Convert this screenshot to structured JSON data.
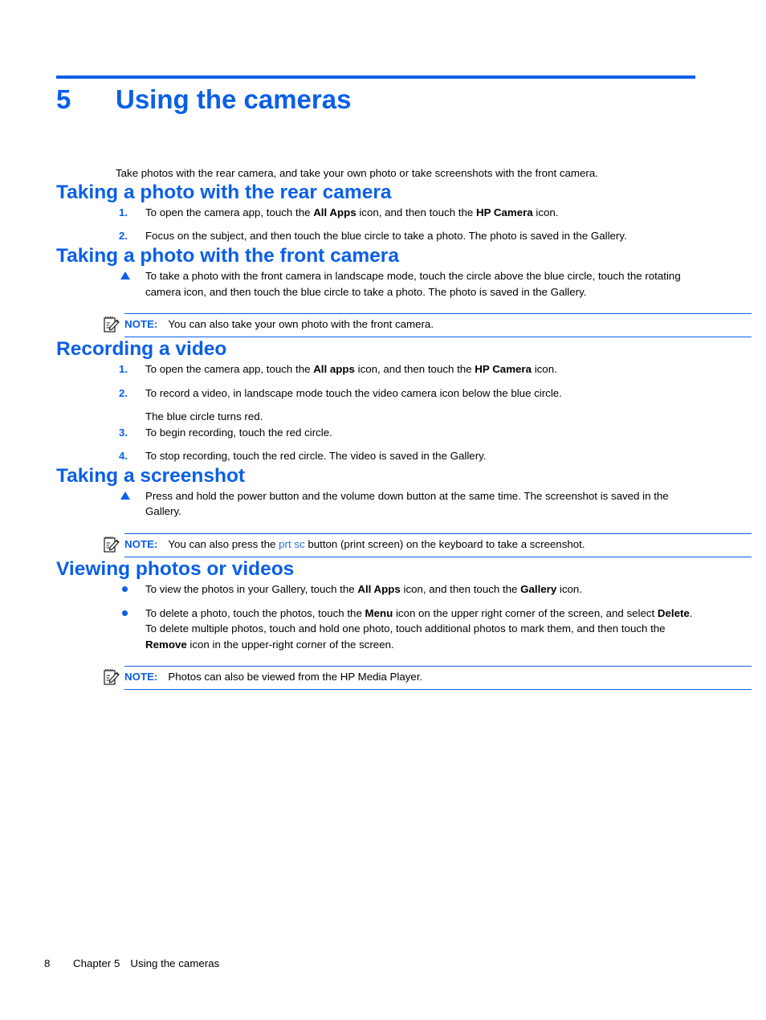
{
  "chapter": {
    "number": "5",
    "title": "Using the cameras"
  },
  "intro": "Take photos with the rear camera, and take your own photo or take screenshots with the front camera.",
  "sections": {
    "rear": {
      "heading": "Taking a photo with the rear camera",
      "step1_marker": "1.",
      "step1_a": "To open the camera app, touch the ",
      "step1_b": "All Apps",
      "step1_c": " icon, and then touch the ",
      "step1_d": "HP Camera",
      "step1_e": " icon.",
      "step2_marker": "2.",
      "step2_text": "Focus on the subject, and then touch the blue circle to take a photo. The photo is saved in the Gallery."
    },
    "front": {
      "heading": "Taking a photo with the front camera",
      "step_text": "To take a photo with the front camera in landscape mode, touch the circle above the blue circle, touch the rotating camera icon, and then touch the blue circle to take a photo. The photo is saved in the Gallery.",
      "note_label": "NOTE:",
      "note_text": "You can also take your own photo with the front camera."
    },
    "video": {
      "heading": "Recording a video",
      "step1_marker": "1.",
      "step1_a": "To open the camera app, touch the ",
      "step1_b": "All apps",
      "step1_c": " icon, and then touch the ",
      "step1_d": "HP Camera",
      "step1_e": " icon.",
      "step2_marker": "2.",
      "step2_text": "To record a video, in landscape mode touch the video camera icon below the blue circle.",
      "substep_text": "The blue circle turns red.",
      "step3_marker": "3.",
      "step3_text": "To begin recording, touch the red circle.",
      "step4_marker": "4.",
      "step4_text": "To stop recording, touch the red circle. The video is saved in the Gallery."
    },
    "screenshot": {
      "heading": "Taking a screenshot",
      "step_text": "Press and hold the power button and the volume down button at the same time. The screenshot is saved in the Gallery.",
      "note_label": "NOTE:",
      "note_a": "You can also press the ",
      "note_key": "prt sc",
      "note_b": " button (print screen) on the keyboard to take a screenshot."
    },
    "viewing": {
      "heading": "Viewing photos or videos",
      "bullet1_a": "To view the photos in your Gallery, touch the ",
      "bullet1_b": "All Apps",
      "bullet1_c": " icon, and then touch the ",
      "bullet1_d": "Gallery",
      "bullet1_e": " icon.",
      "bullet2_a": "To delete a photo, touch the photos, touch the ",
      "bullet2_b": "Menu",
      "bullet2_c": " icon on the upper right corner of the screen, and select ",
      "bullet2_d": "Delete",
      "bullet2_e": ". To delete multiple photos, touch and hold one photo, touch additional photos to mark them, and then touch the ",
      "bullet2_f": "Remove",
      "bullet2_g": " icon in the upper-right corner of the screen.",
      "note_label": "NOTE:",
      "note_text": "Photos can also be viewed from the HP Media Player."
    }
  },
  "footer": {
    "page_number": "8",
    "chapter_label": "Chapter 5",
    "chapter_title": "Using the cameras"
  },
  "colors": {
    "accent_blue": "#0a5fe8",
    "xref_blue": "#2a6fdb",
    "text_black": "#000000"
  },
  "icons": {
    "note": "note-pad-pencil-icon",
    "triangle_bullet": "triangle-bullet-icon",
    "dot_bullet": "dot-bullet-icon"
  }
}
